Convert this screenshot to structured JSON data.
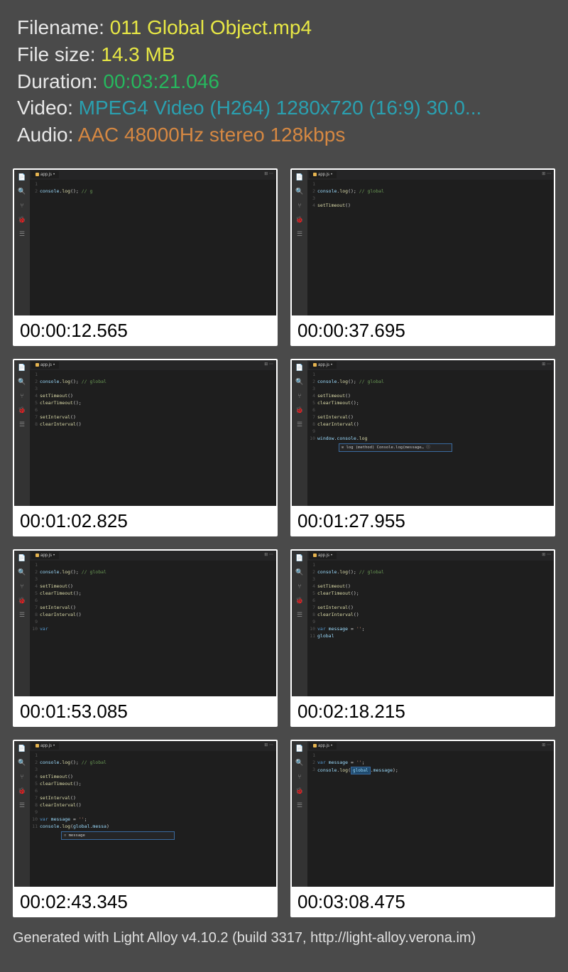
{
  "info": {
    "filename_label": "Filename: ",
    "filename_value": "011 Global Object.mp4",
    "filesize_label": "File size: ",
    "filesize_value": "14.3 MB",
    "duration_label": "Duration: ",
    "duration_value": "00:03:21.046",
    "video_label": "Video: ",
    "video_value": "MPEG4 Video (H264) 1280x720 (16:9) 30.0...",
    "audio_label": "Audio: ",
    "audio_value": "AAC 48000Hz stereo 128kbps"
  },
  "tab_label": "app.js",
  "thumbs": [
    {
      "timestamp": "00:00:12.565",
      "lines": [
        "1",
        "2"
      ],
      "code": [
        "",
        "<span class='kw-obj'>console</span>.<span class='kw-func'>log</span>(); <span class='kw-comment'>// g</span>"
      ]
    },
    {
      "timestamp": "00:00:37.695",
      "lines": [
        "1",
        "2",
        "3",
        "4"
      ],
      "code": [
        "",
        "<span class='kw-obj'>console</span>.<span class='kw-func'>log</span>(); <span class='kw-comment'>// global</span>",
        "",
        "<span class='kw-func'>setTimeout</span>()"
      ]
    },
    {
      "timestamp": "00:01:02.825",
      "lines": [
        "1",
        "2",
        "3",
        "4",
        "5",
        "6",
        "7",
        "8"
      ],
      "code": [
        "",
        "<span class='kw-obj'>console</span>.<span class='kw-func'>log</span>(); <span class='kw-comment'>// global</span>",
        "",
        "<span class='kw-func'>setTimeout</span>()",
        "<span class='kw-func'>clearTimeout</span>();",
        "",
        "<span class='kw-func'>setInterval</span>()",
        "<span class='kw-func'>clearInterval</span>()"
      ]
    },
    {
      "timestamp": "00:01:27.955",
      "lines": [
        "1",
        "2",
        "3",
        "4",
        "5",
        "6",
        "7",
        "8",
        "9",
        "10"
      ],
      "code": [
        "",
        "<span class='kw-obj'>console</span>.<span class='kw-func'>log</span>(); <span class='kw-comment'>// global</span>",
        "",
        "<span class='kw-func'>setTimeout</span>()",
        "<span class='kw-func'>clearTimeout</span>();",
        "",
        "<span class='kw-func'>setInterval</span>()",
        "<span class='kw-func'>clearInterval</span>()",
        "",
        "<span class='kw-obj'>window</span>.<span class='kw-obj'>console</span>.<span class='kw-func'>log</span>"
      ],
      "suggest": "⊙ log (method) Console.log(message… ⓘ",
      "suggest_wide": true
    },
    {
      "timestamp": "00:01:53.085",
      "lines": [
        "1",
        "2",
        "3",
        "4",
        "5",
        "6",
        "7",
        "8",
        "9",
        "10"
      ],
      "code": [
        "",
        "<span class='kw-obj'>console</span>.<span class='kw-func'>log</span>(); <span class='kw-comment'>// global</span>",
        "",
        "<span class='kw-func'>setTimeout</span>()",
        "<span class='kw-func'>clearTimeout</span>();",
        "",
        "<span class='kw-func'>setInterval</span>()",
        "<span class='kw-func'>clearInterval</span>()",
        "",
        "<span class='kw-var'>var</span> "
      ]
    },
    {
      "timestamp": "00:02:18.215",
      "lines": [
        "1",
        "2",
        "3",
        "4",
        "5",
        "6",
        "7",
        "8",
        "9",
        "10",
        "11"
      ],
      "code": [
        "",
        "<span class='kw-obj'>console</span>.<span class='kw-func'>log</span>(); <span class='kw-comment'>// global</span>",
        "",
        "<span class='kw-func'>setTimeout</span>()",
        "<span class='kw-func'>clearTimeout</span>();",
        "",
        "<span class='kw-func'>setInterval</span>()",
        "<span class='kw-func'>clearInterval</span>()",
        "",
        "<span class='kw-var'>var</span> <span class='kw-obj'>message</span> = <span class='kw-str'>''</span>;",
        "<span class='kw-obj'>global</span>"
      ]
    },
    {
      "timestamp": "00:02:43.345",
      "lines": [
        "1",
        "2",
        "3",
        "4",
        "5",
        "6",
        "7",
        "8",
        "9",
        "10",
        "11"
      ],
      "code": [
        "",
        "<span class='kw-obj'>console</span>.<span class='kw-func'>log</span>(); <span class='kw-comment'>// global</span>",
        "",
        "<span class='kw-func'>setTimeout</span>()",
        "<span class='kw-func'>clearTimeout</span>();",
        "",
        "<span class='kw-func'>setInterval</span>()",
        "<span class='kw-func'>clearInterval</span>()",
        "",
        "<span class='kw-var'>var</span> <span class='kw-obj'>message</span> = <span class='kw-str'>''</span>;",
        "<span class='kw-obj'>console</span>.<span class='kw-func'>log</span>(<span class='kw-obj'>global</span>.<span class='kw-obj'>messa</span>)"
      ],
      "suggest": "▫ message",
      "suggest_wide": true
    },
    {
      "timestamp": "00:03:08.475",
      "lines": [
        "1",
        "2",
        "3"
      ],
      "code": [
        "",
        "<span class='kw-var'>var</span> <span class='kw-obj'>message</span> = <span class='kw-str'>''</span>;",
        "<span class='kw-obj'>console</span>.<span class='kw-func'>log</span>(<span class='highlight'>global</span>.<span class='kw-obj'>message</span>);"
      ]
    }
  ],
  "footer": "Generated with Light Alloy v4.10.2 (build 3317, http://light-alloy.verona.im)"
}
